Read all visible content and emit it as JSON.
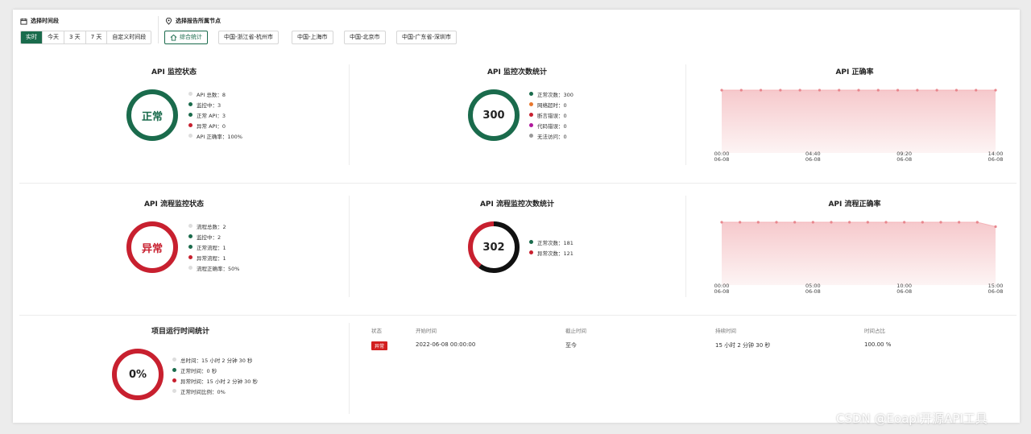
{
  "header": {
    "time_label": "选择时间段",
    "time_options": [
      "实时",
      "今天",
      "3 天",
      "7 天",
      "自定义时间段"
    ],
    "node_label": "选择报告所属节点",
    "node_options": [
      "综合统计",
      "中国-浙江省-杭州市",
      "中国-上海市",
      "中国-北京市",
      "中国-广东省-深圳市"
    ]
  },
  "api_status": {
    "title": "API 监控状态",
    "ring_text": "正常",
    "legend": [
      {
        "text": "API 总数：8",
        "color": "#dddddd"
      },
      {
        "text": "监控中：3",
        "color": "#1a6b4c"
      },
      {
        "text": "正常 API：3",
        "color": "#1a6b4c"
      },
      {
        "text": "异常 API：0",
        "color": "#c8202f"
      },
      {
        "text": "API 正确率：100%",
        "color": "#dddddd"
      }
    ]
  },
  "api_count": {
    "title": "API 监控次数统计",
    "ring_text": "300",
    "legend": [
      {
        "text": "正常次数：300",
        "color": "#1a6b4c"
      },
      {
        "text": "网络超时：0",
        "color": "#e8772e"
      },
      {
        "text": "断言错误：0",
        "color": "#c8202f"
      },
      {
        "text": "代码错误：0",
        "color": "#b0199c"
      },
      {
        "text": "无法访问：0",
        "color": "#999999"
      }
    ]
  },
  "api_accuracy": {
    "title": "API 正确率",
    "ticks": [
      {
        "time": "00:00",
        "date": "06-08"
      },
      {
        "time": "04:40",
        "date": "06-08"
      },
      {
        "time": "09:20",
        "date": "06-08"
      },
      {
        "time": "14:00",
        "date": "06-08"
      }
    ]
  },
  "flow_status": {
    "title": "API 流程监控状态",
    "ring_text": "异常",
    "legend": [
      {
        "text": "流程总数：2",
        "color": "#dddddd"
      },
      {
        "text": "监控中：2",
        "color": "#1a6b4c"
      },
      {
        "text": "正常流程：1",
        "color": "#1a6b4c"
      },
      {
        "text": "异常流程：1",
        "color": "#c8202f"
      },
      {
        "text": "流程正确率：50%",
        "color": "#dddddd"
      }
    ]
  },
  "flow_count": {
    "title": "API 流程监控次数统计",
    "ring_text": "302",
    "legend": [
      {
        "text": "正常次数：181",
        "color": "#1a6b4c"
      },
      {
        "text": "异常次数：121",
        "color": "#c8202f"
      }
    ]
  },
  "flow_accuracy": {
    "title": "API 流程正确率",
    "ticks": [
      {
        "time": "00:00",
        "date": "06-08"
      },
      {
        "time": "05:00",
        "date": "06-08"
      },
      {
        "time": "10:00",
        "date": "06-08"
      },
      {
        "time": "15:00",
        "date": "06-08"
      }
    ]
  },
  "runtime": {
    "title": "项目运行时间统计",
    "ring_text": "0%",
    "legend": [
      {
        "text": "总时间：15 小时 2 分钟 30 秒",
        "color": "#dddddd"
      },
      {
        "text": "正常时间：0 秒",
        "color": "#1a6b4c"
      },
      {
        "text": "异常时间：15 小时 2 分钟 30 秒",
        "color": "#c8202f"
      },
      {
        "text": "正常时间比例：0%",
        "color": "#dddddd"
      }
    ]
  },
  "runtime_table": {
    "headers": [
      "状态",
      "开始时间",
      "截止时间",
      "持续时间",
      "时间占比"
    ],
    "row": {
      "status": "异常",
      "start": "2022-06-08 00:00:00",
      "end": "至今",
      "duration": "15 小时 2 分钟 30 秒",
      "ratio": "100.00 %"
    }
  },
  "chart_data": [
    {
      "type": "area",
      "title": "API 正确率",
      "x": [
        "00:00",
        "01:00",
        "02:00",
        "03:00",
        "04:00",
        "05:00",
        "06:00",
        "07:00",
        "08:00",
        "09:00",
        "10:00",
        "11:00",
        "12:00",
        "13:00",
        "14:00"
      ],
      "x_tick_labels": [
        "00:00 06-08",
        "04:40 06-08",
        "09:20 06-08",
        "14:00 06-08"
      ],
      "series": [
        {
          "values": [
            100,
            100,
            100,
            100,
            100,
            100,
            100,
            100,
            100,
            100,
            100,
            100,
            100,
            100,
            100
          ]
        }
      ],
      "ylim": [
        0,
        100
      ]
    },
    {
      "type": "area",
      "title": "API 流程正确率",
      "x": [
        "00:00",
        "01:00",
        "02:00",
        "03:00",
        "04:00",
        "05:00",
        "06:00",
        "07:00",
        "08:00",
        "09:00",
        "10:00",
        "11:00",
        "12:00",
        "13:00",
        "14:00",
        "15:00"
      ],
      "x_tick_labels": [
        "00:00 06-08",
        "05:00 06-08",
        "10:00 06-08",
        "15:00 06-08"
      ],
      "series": [
        {
          "values": [
            100,
            100,
            100,
            100,
            100,
            100,
            100,
            100,
            100,
            100,
            100,
            100,
            100,
            100,
            100,
            93
          ]
        }
      ],
      "ylim": [
        0,
        100
      ]
    }
  ],
  "watermark": "CSDN @Eoapi开源API工具",
  "colors": {
    "green": "#1a6b4c",
    "red": "#c8202f",
    "black": "#111111"
  }
}
